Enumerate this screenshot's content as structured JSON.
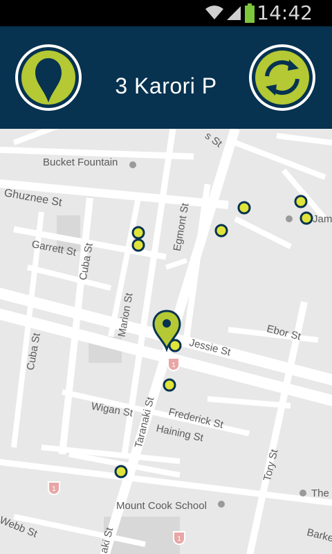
{
  "status": {
    "time": "14:42"
  },
  "header": {
    "title": "3 Karori P",
    "left_button_icon": "location-pin-icon",
    "right_button_icon": "refresh-arrows-icon",
    "accent": "#b4c934",
    "background": "#073250"
  },
  "map": {
    "labels": {
      "bucket_fountain": "Bucket Fountain",
      "ghuznee": "Ghuznee St",
      "garrett": "Garrett St",
      "cuba_top": "Cuba St",
      "cuba_bottom": "Cuba St",
      "marion": "Marion St",
      "egmont": "Egmont St",
      "jessie": "Jessie St",
      "ebor": "Ebor St",
      "frederick": "Frederick St",
      "wigan": "Wigan St",
      "haining": "Haining St",
      "taranaki_top": "Taranaki St",
      "taranaki_bottom": "aki St",
      "tory": "Tory St",
      "webb": "Webb St",
      "barker": "Barke",
      "mount_cook": "Mount Cook School",
      "the_te": "The",
      "jam": "Jam",
      "st_top": "s St",
      "route_1": "1"
    },
    "stop_marker_color": "#e0e33a",
    "selected_pin_color": "#b4c934"
  }
}
